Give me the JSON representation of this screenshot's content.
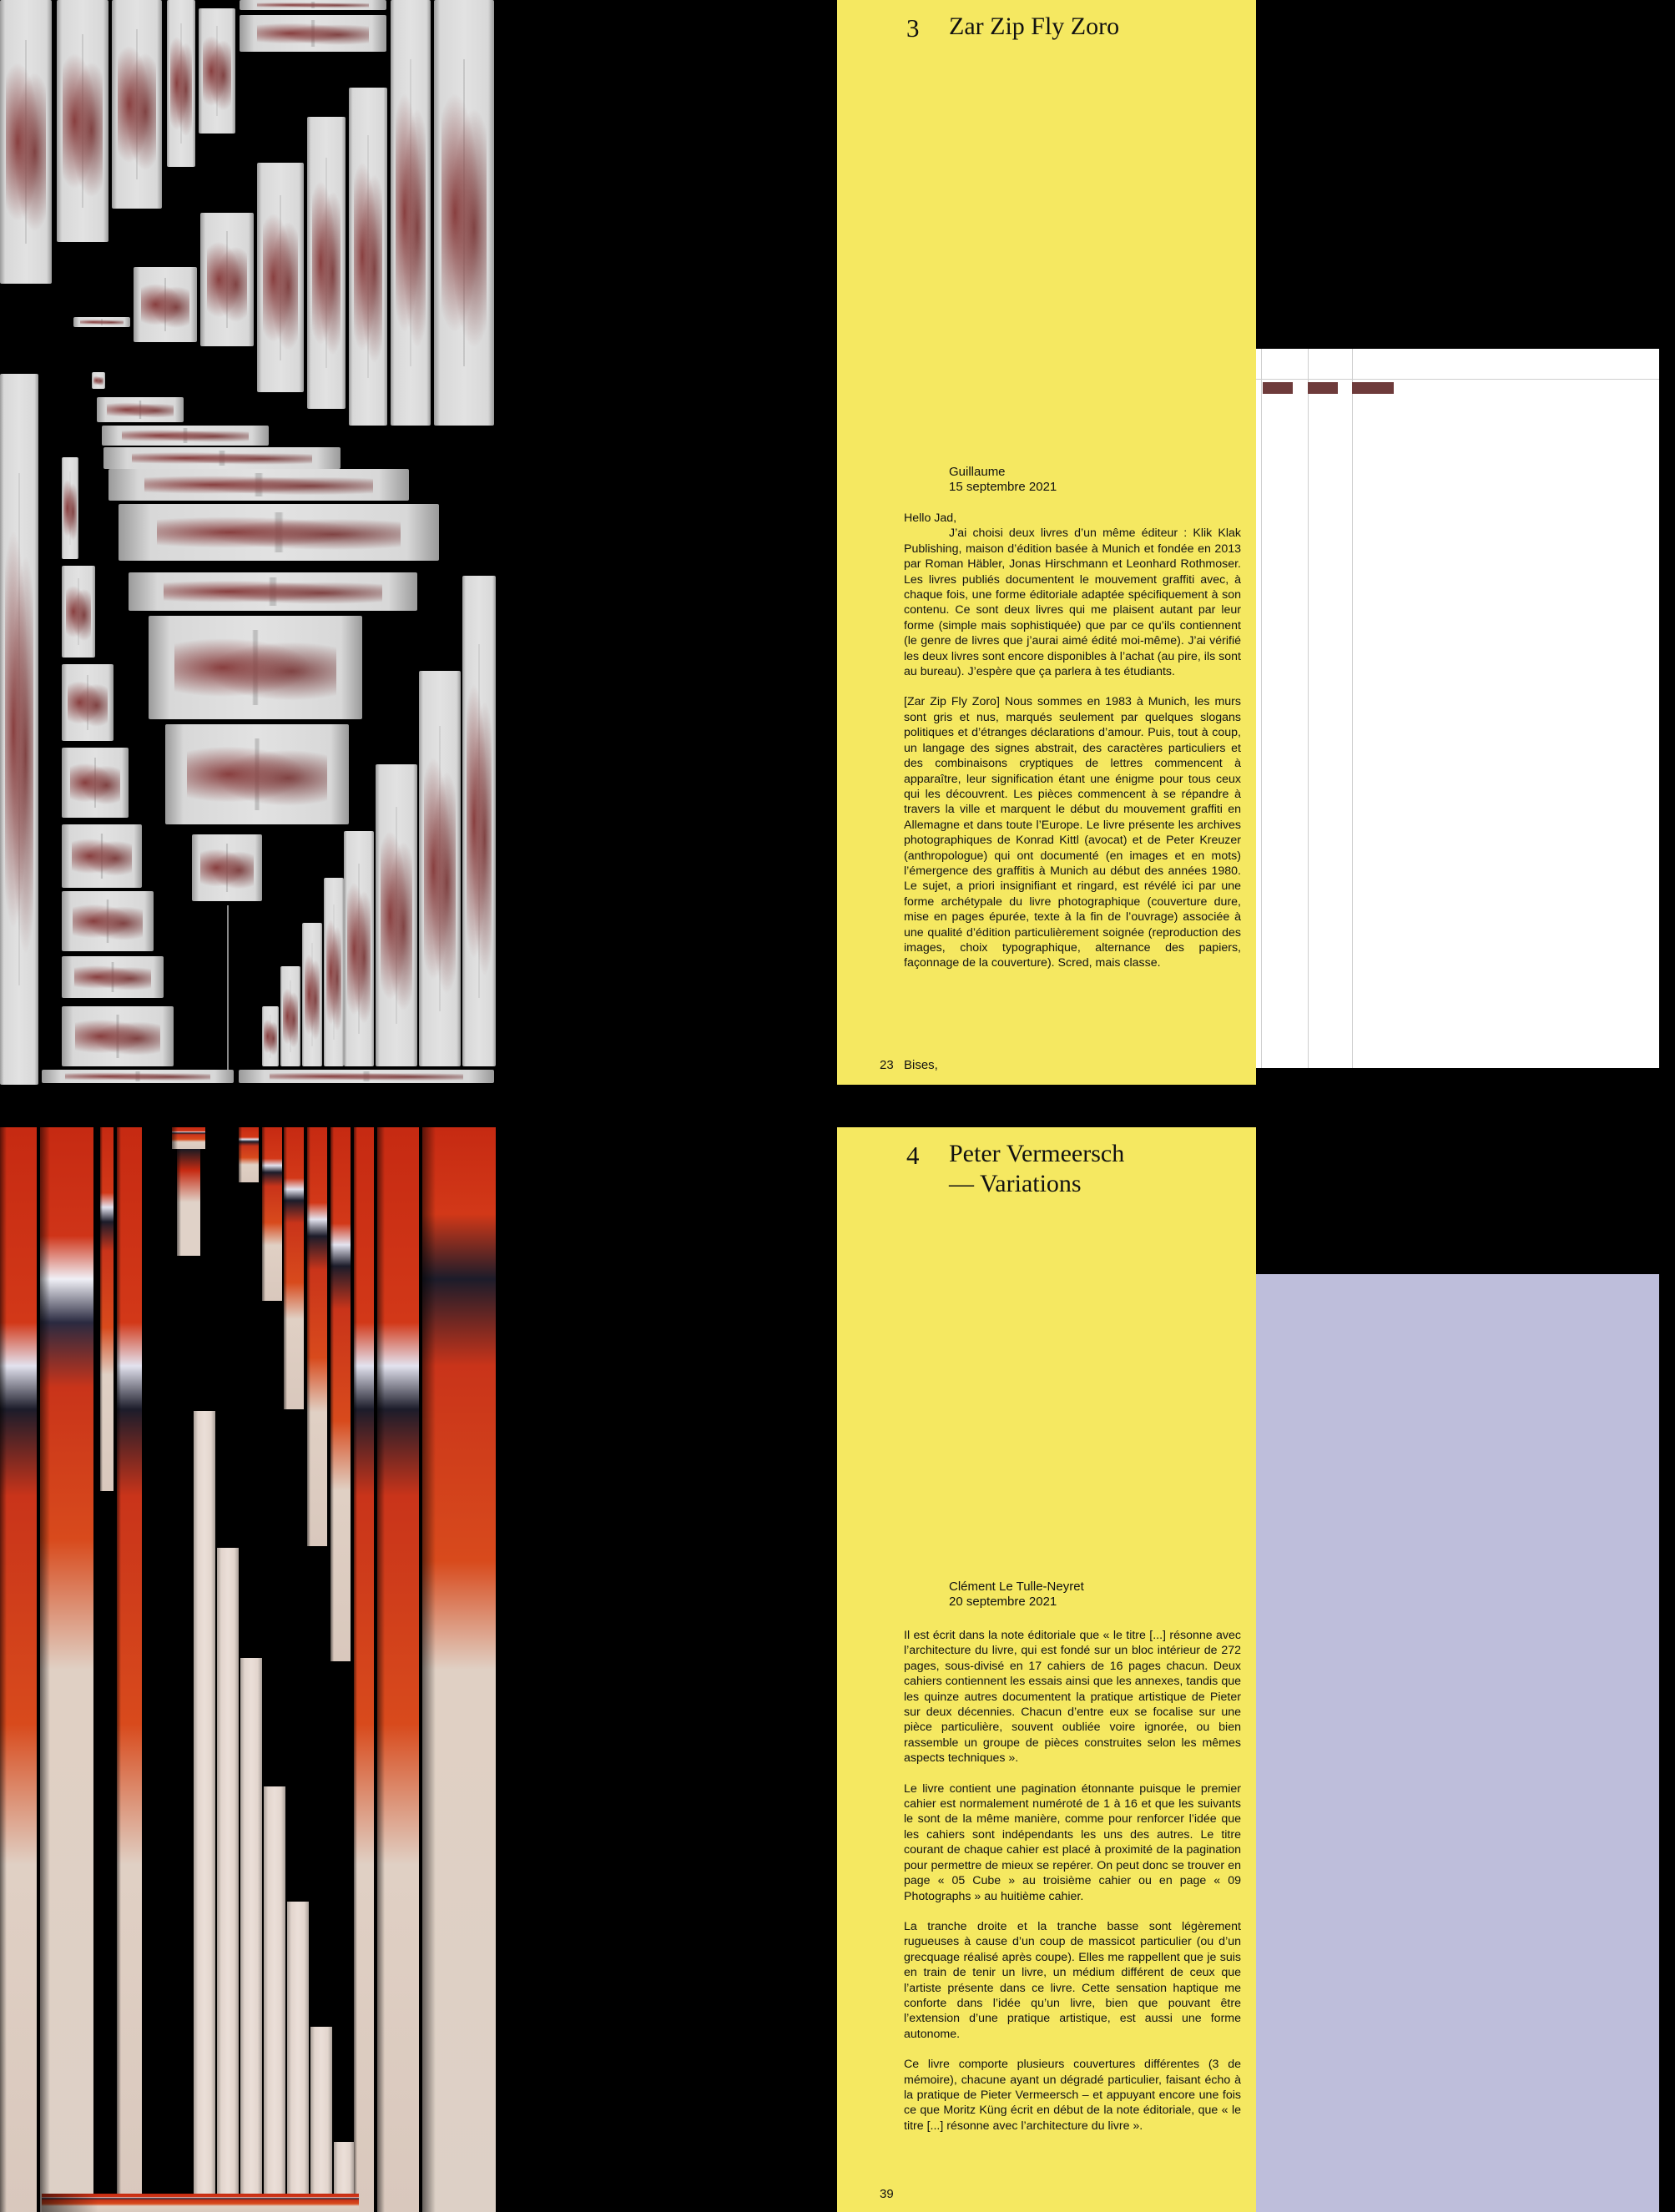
{
  "spreads": [
    {
      "number": "3",
      "title": "Zar Zip Fly Zoro",
      "author": "Guillaume",
      "date": "15 septembre 2021",
      "greeting": "Hello Jad,",
      "paragraphs": [
        "J’ai choisi deux livres d’un même éditeur : Klik Klak Publishing, maison d’édition basée à Munich et fondée en 2013 par Roman Häbler, Jonas Hirschmann et Leonhard Rothmoser. Les livres publiés documentent le mouvement graffiti avec, à chaque fois, une forme éditoriale adaptée spécifiquement à son contenu. Ce sont deux livres qui me plaisent autant par leur forme (simple mais sophistiquée) que par ce qu’ils contiennent (le genre de livres que j’aurai aimé édité moi-même). J’ai vérifié les deux livres sont encore disponibles à l’achat (au pire, ils sont au bureau). J’espère que ça parlera à tes étudiants.",
        "[Zar Zip Fly Zoro] Nous sommes en 1983 à Munich, les murs sont gris et nus, marqués seulement par quelques slogans politiques et d’étranges déclarations d’amour. Puis, tout à coup, un langage des signes abstrait, des caractères particuliers et des combinaisons cryptiques de lettres commencent à apparaître, leur signification étant une énigme pour tous ceux qui les découvrent. Les pièces commencent à se répandre à travers la ville et marquent le début du mouvement graffiti en Allemagne et dans toute l’Europe. Le livre présente les archives photographiques de Konrad Kittl (avocat) et de Peter Kreuzer (anthropologue) qui ont documenté (en images et en mots) l’émergence des graffitis à Munich au début des années 1980. Le sujet, a priori insignifiant et ringard, est révélé ici par une forme archétypale du livre photographique (couverture dure, mise en pages épurée, texte à la fin de l’ouvrage) associée à une qualité d’édition particulièrement soignée (reproduction des images, choix typographique, alternance des papiers, façonnage de la couverture). Scred, mais classe."
      ],
      "folio": "23",
      "signoff": "Bises,"
    },
    {
      "number": "4",
      "title": "Peter Vermeersch\n— Variations",
      "author": "Clément Le Tulle-Neyret",
      "date": "20 septembre 2021",
      "paragraphs": [
        "Il est écrit dans la note éditoriale que « le titre [...] résonne avec l’architecture du livre, qui est fondé sur un bloc intérieur de 272 pages, sous-divisé en 17 cahiers de 16 pages chacun. Deux cahiers contiennent les essais ainsi que les annexes, tandis que les quinze autres documentent la pratique artistique de Pieter sur deux décennies. Chacun d’entre eux se focalise sur une pièce particulière, souvent oubliée voire ignorée, ou bien rassemble un groupe de pièces construites selon les mêmes aspects techniques ».",
        "Le livre contient une pagination étonnante puisque le premier cahier est normalement numéroté de 1 à 16 et que les suivants le sont de la même manière, comme pour renforcer l’idée que les cahiers sont indépendants les uns des autres. Le titre courant de chaque cahier est placé à proximité de la pagination pour permettre de mieux se repérer. On peut donc se trouver en page « 05 Cube » au troisième cahier ou en page « 09 Photographs » au huitième cahier.",
        "La tranche droite et la tranche basse sont légèrement rugueuses à cause d’un coup de massicot particulier (ou d’un grecquage réalisé après coupe). Elles me rappellent que je suis en train de tenir un livre, un médium différent de ceux que l’artiste présente dans ce livre. Cette sensation haptique me conforte dans l’idée qu’un livre, bien que pouvant être l’extension d’une pratique artistique, est aussi une forme autonome.",
        "Ce livre comporte plusieurs couvertures différentes (3 de mémoire), chacune ayant un dégradé particulier, faisant écho à la pratique de Pieter Vermeersch – et appuyant encore une fois ce que Moritz Küng écrit en début de la note éditoriale, que « le titre [...] résonne avec l’architecture du livre »."
      ],
      "folio": "39"
    }
  ],
  "colors": {
    "page_yellow": "#f5e861",
    "panel_lilac": "#bebedb",
    "mark_brown": "#6e3b3b"
  }
}
